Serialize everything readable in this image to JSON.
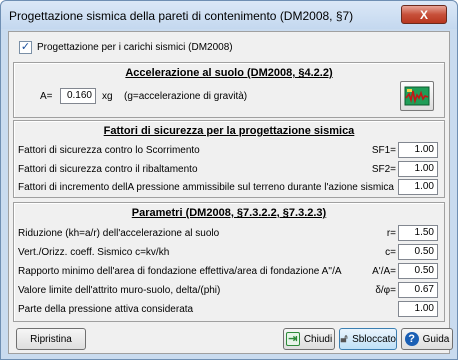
{
  "window": {
    "title": "Progettazione sismica della pareti di contenimento (DM2008, §7)",
    "close_glyph": "X"
  },
  "checkbox": {
    "label": "Progettazione per i carichi sismici (DM2008)",
    "checked": true
  },
  "accel": {
    "header": "Accelerazione al suolo (DM2008, §4.2.2)",
    "a_label": "A=",
    "a_value": "0.160",
    "a_unit": "xg",
    "a_note": "(g=accelerazione di gravità)",
    "tool_icon": "seismic-graph-icon"
  },
  "safety": {
    "header": "Fattori di sicurezza per la progettazione sismica",
    "rows": [
      {
        "label": "Fattori di sicurezza contro lo Scorrimento",
        "symbol": "SF1=",
        "value": "1.00"
      },
      {
        "label": "Fattori di sicurezza contro il ribaltamento",
        "symbol": "SF2=",
        "value": "1.00"
      },
      {
        "label": "Fattori di incremento dellA pressione ammissibile sul terreno durante l'azione sismica",
        "symbol": "",
        "value": "1.00"
      }
    ]
  },
  "params": {
    "header": "Parametri (DM2008, §7.3.2.2, §7.3.2.3)",
    "rows": [
      {
        "label": "Riduzione (kh=a/r) dell'accelerazione al suolo",
        "symbol": "r=",
        "value": "1.50"
      },
      {
        "label": "Vert./Orizz. coeff. Sismico c=kv/kh",
        "symbol": "c=",
        "value": "0.50"
      },
      {
        "label": "Rapporto minimo dell'area di fondazione effettiva/area di fondazione A''/A",
        "symbol": "A'/A=",
        "value": "0.50"
      },
      {
        "label": "Valore limite dell'attrito muro-suolo, delta/(phi)",
        "symbol": "δ/φ=",
        "value": "0.67"
      },
      {
        "label": "Parte della pressione attiva considerata",
        "symbol": "",
        "value": "1.00"
      }
    ]
  },
  "buttons": {
    "reset": "Ripristina",
    "close": "Chiudi",
    "unlock": "Sbloccato",
    "help": "Guida"
  },
  "colors": {
    "accent": "#3c7fb1",
    "help_icon": "#1a5fb4",
    "close_icon": "#2e8b3a"
  }
}
